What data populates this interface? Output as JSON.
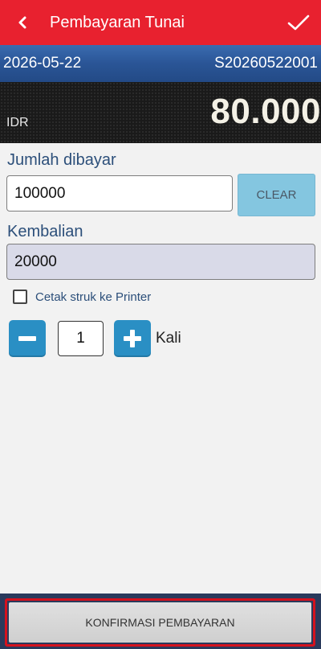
{
  "header": {
    "title": "Pembayaran Tunai",
    "back_icon": "chevron-left-icon",
    "confirm_icon": "check-icon"
  },
  "info": {
    "date": "2026-05-22",
    "transaction_id": "S20260522001"
  },
  "amount": {
    "currency": "IDR",
    "total": "80.000"
  },
  "form": {
    "paid_label": "Jumlah dibayar",
    "paid_value": "100000",
    "clear_label": "CLEAR",
    "change_label": "Kembalian",
    "change_value": "20000",
    "print_label": "Cetak struk ke Printer",
    "print_checked": false,
    "copies_value": "1",
    "copies_unit": "Kali"
  },
  "footer": {
    "confirm_label": "KONFIRMASI PEMBAYARAN"
  },
  "colors": {
    "header_red": "#e8212f",
    "info_blue": "#2a5596",
    "accent_blue": "#2a8fc4",
    "clear_blue": "#84c6e0",
    "highlight_red": "#d4121e"
  }
}
